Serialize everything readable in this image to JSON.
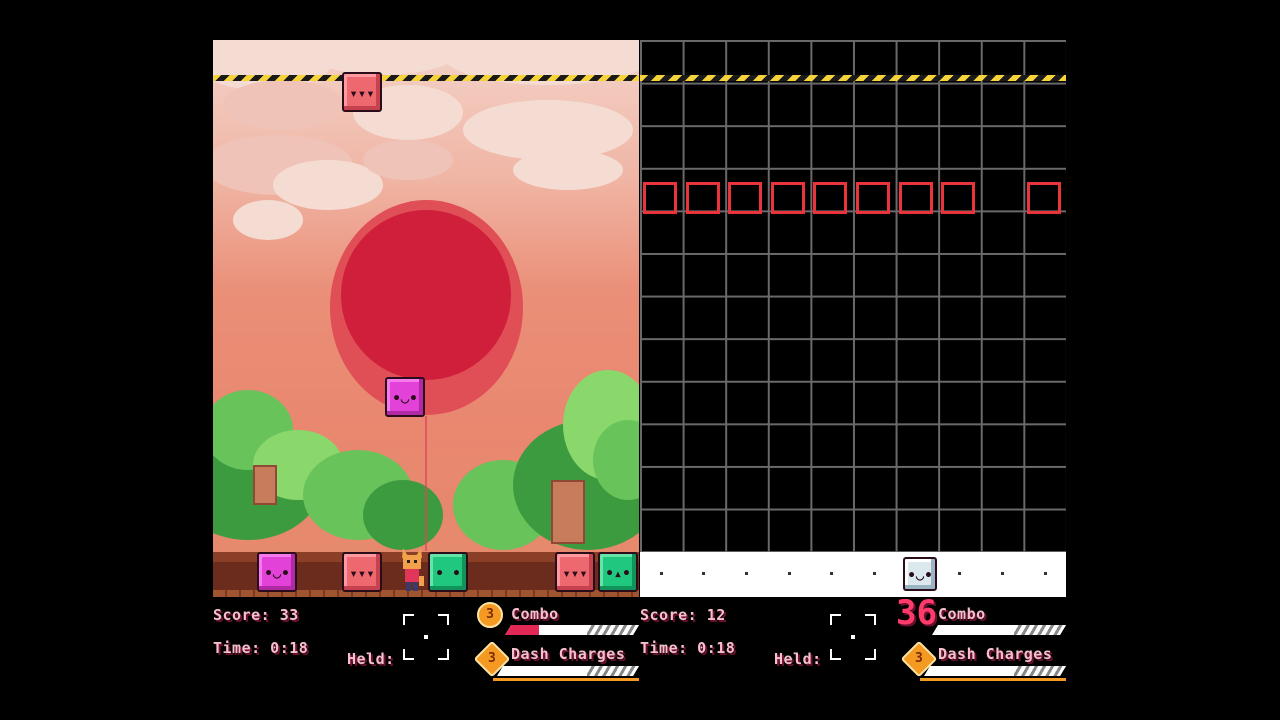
{
  "player1": {
    "score_text": "Score: 33",
    "time_text": "Time: 0:18",
    "held_label": "Held:",
    "combo_badge": "3",
    "combo_label": "Combo",
    "dash_badge": "3",
    "dash_label": "Dash Charges",
    "combo_fill_fraction": 0.25,
    "dash_fill_fraction": 0.0,
    "falling_blocks": [
      "red",
      "magenta"
    ],
    "bottom_row": [
      "magenta",
      "red",
      "green",
      "red",
      "green"
    ]
  },
  "player2": {
    "score_text": "Score: 12",
    "time_text": "Time: 0:18",
    "held_label": "Held:",
    "combo_count": "36",
    "combo_label": "Combo",
    "dash_badge": "3",
    "dash_label": "Dash Charges",
    "combo_fill_fraction": 0.0,
    "dash_fill_fraction": 0.0,
    "bottom_row_block": "white"
  },
  "colors": {
    "magenta": "#e342d8",
    "red": "#ee6870",
    "green": "#20c77f",
    "white": "#dbe9ef",
    "ghost_outline": "#e8343a",
    "hud_text": "#f4c0cc",
    "badge": "#f49a22"
  }
}
